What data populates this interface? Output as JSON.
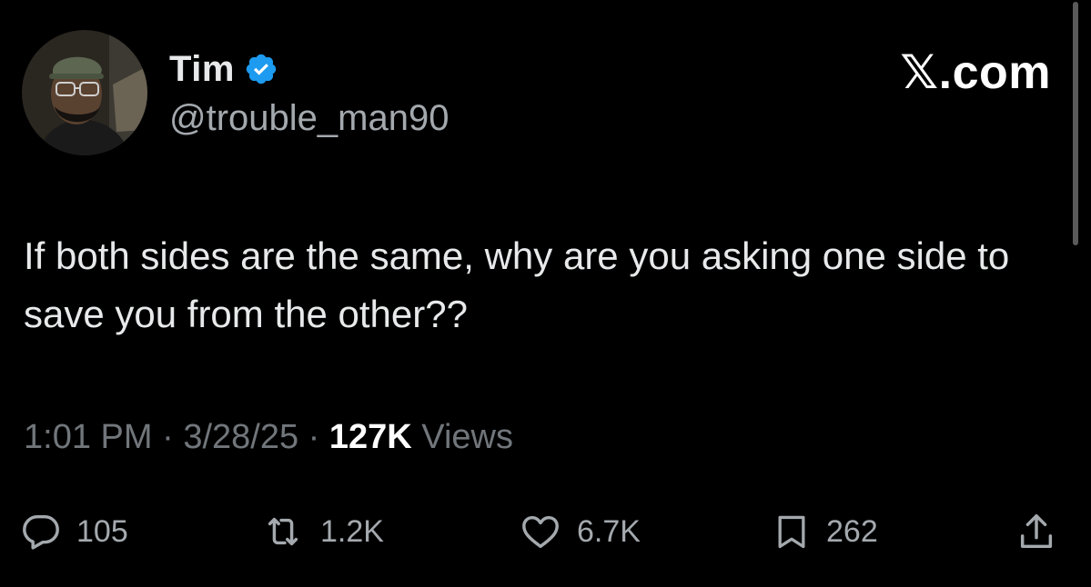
{
  "author": {
    "display_name": "Tim",
    "handle": "@trouble_man90",
    "verified": true,
    "verified_icon": "verified-badge-icon",
    "verified_color": "#1d9bf0"
  },
  "source": {
    "label": "𝕏.com"
  },
  "tweet": {
    "text": "If both sides are the same, why are you asking one side to save you from the other??"
  },
  "meta": {
    "time": "1:01 PM",
    "date": "3/28/25",
    "separator": "·",
    "views_count": "127K",
    "views_label": "Views"
  },
  "actions": {
    "reply": {
      "icon": "reply-icon",
      "count": "105"
    },
    "repost": {
      "icon": "repost-icon",
      "count": "1.2K"
    },
    "like": {
      "icon": "heart-icon",
      "count": "6.7K"
    },
    "bookmark": {
      "icon": "bookmark-icon",
      "count": "262"
    },
    "share": {
      "icon": "share-icon"
    }
  },
  "colors": {
    "background": "#000000",
    "primary_text": "#e7e9ea",
    "secondary_text": "#71767b",
    "action_text": "#a4a9ae"
  }
}
